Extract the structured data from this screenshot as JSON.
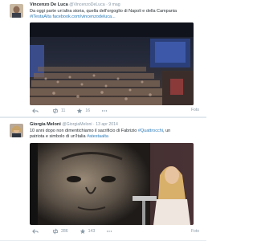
{
  "tweets": [
    {
      "author_name": "Vincenzo De Luca",
      "author_handle": "@VincenzoDeLuca",
      "time": "· 9 mag",
      "text_line1": "Da oggi parte un'altra storia, quella dell'orgoglio di Napoli e della Campania",
      "hashtag": "#iTestaAlta",
      "link": "facebook.com/vincenzodeluca...",
      "reply_count": "",
      "retweet_count": "11",
      "favorite_count": "16",
      "media_label": "Foto"
    },
    {
      "author_name": "Giorgia Meloni",
      "author_handle": "@GiorgiaMeloni",
      "time": "· 13 apr 2014",
      "text_line1": "10 anni dopo non dimentichiamo il sacrificio di Fabrizio",
      "mention": "#Quattrocchi",
      "text_line1_end": ", un",
      "text_line2": "patriota e simbolo di un'Italia",
      "hashtag": "#atestaalta",
      "reply_count": "",
      "retweet_count": "286",
      "favorite_count": "143",
      "media_label": "Foto"
    }
  ]
}
